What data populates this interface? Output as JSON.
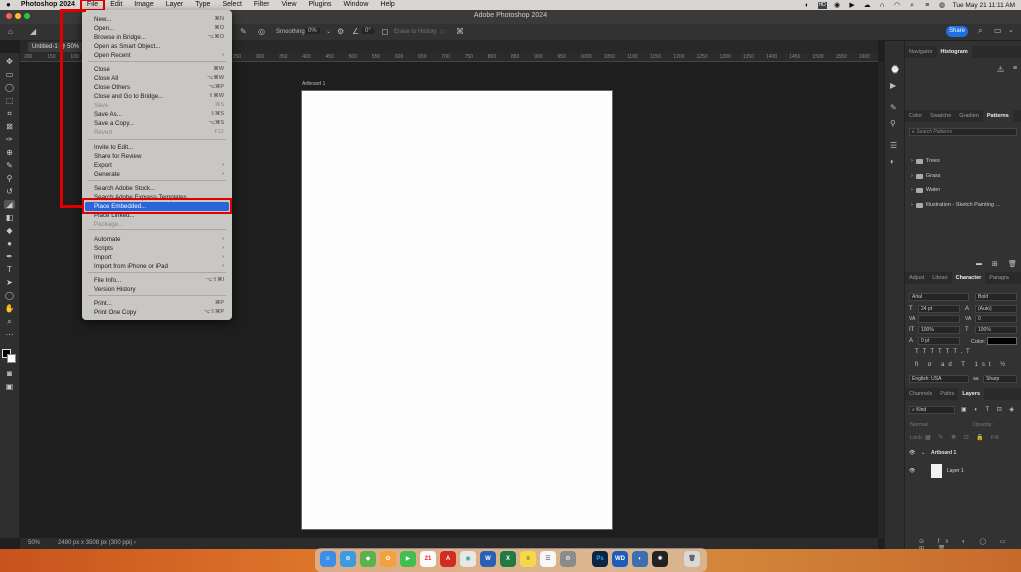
{
  "macos_menubar": {
    "app_name": "Photoshop 2024",
    "menus": [
      "File",
      "Edit",
      "Image",
      "Layer",
      "Type",
      "Select",
      "Filter",
      "View",
      "Plugins",
      "Window",
      "Help"
    ],
    "clock": "Tue May 21  11:11 AM"
  },
  "window": {
    "title": "Adobe Photoshop 2024"
  },
  "options_bar": {
    "smoothing_label": "Smoothing:",
    "smoothing_value": "0%",
    "angle_value": "0°",
    "erase_label": "Erase to History",
    "share_label": "Share"
  },
  "document": {
    "tab_title": "Untitled-1 @ 50%",
    "artboard_label": "Artboard 1",
    "zoom": "50%",
    "doc_info": "2480 px x 3508 px (300 ppi)",
    "ruler_ticks": [
      "200",
      "150",
      "100",
      "50",
      "0",
      "50",
      "100",
      "150",
      "200",
      "250",
      "300",
      "350",
      "400",
      "450",
      "500",
      "550",
      "600",
      "650",
      "700",
      "750",
      "800",
      "850",
      "900",
      "950",
      "1000",
      "1050",
      "1100",
      "1150",
      "1200",
      "1250",
      "1300",
      "1350",
      "1400",
      "1450",
      "1500",
      "1550",
      "1600"
    ]
  },
  "file_menu": {
    "items": [
      {
        "label": "New...",
        "shortcut": "⌘N",
        "disabled": false
      },
      {
        "label": "Open...",
        "shortcut": "⌘O",
        "disabled": false
      },
      {
        "label": "Browse in Bridge...",
        "shortcut": "⌥⌘O",
        "disabled": false
      },
      {
        "label": "Open as Smart Object...",
        "shortcut": "",
        "disabled": false
      },
      {
        "label": "Open Recent",
        "shortcut": "›",
        "disabled": false
      },
      {
        "label": "Close",
        "shortcut": "⌘W",
        "disabled": false
      },
      {
        "label": "Close All",
        "shortcut": "⌥⌘W",
        "disabled": false
      },
      {
        "label": "Close Others",
        "shortcut": "⌥⌘P",
        "disabled": false
      },
      {
        "label": "Close and Go to Bridge...",
        "shortcut": "⇧⌘W",
        "disabled": false
      },
      {
        "label": "Save",
        "shortcut": "⌘S",
        "disabled": true
      },
      {
        "label": "Save As...",
        "shortcut": "⇧⌘S",
        "disabled": false
      },
      {
        "label": "Save a Copy...",
        "shortcut": "⌥⌘S",
        "disabled": false
      },
      {
        "label": "Revert",
        "shortcut": "F12",
        "disabled": true
      },
      {
        "label": "Invite to Edit...",
        "shortcut": "",
        "disabled": false
      },
      {
        "label": "Share for Review",
        "shortcut": "",
        "disabled": false
      },
      {
        "label": "Export",
        "shortcut": "›",
        "disabled": false
      },
      {
        "label": "Generate",
        "shortcut": "›",
        "disabled": false
      },
      {
        "label": "Search Adobe Stock...",
        "shortcut": "",
        "disabled": false
      },
      {
        "label": "Search Adobe Express Templates...",
        "shortcut": "",
        "disabled": false
      },
      {
        "label": "Place Embedded...",
        "shortcut": "",
        "disabled": false,
        "selected": true
      },
      {
        "label": "Place Linked...",
        "shortcut": "",
        "disabled": false
      },
      {
        "label": "Package...",
        "shortcut": "",
        "disabled": true
      },
      {
        "label": "Automate",
        "shortcut": "›",
        "disabled": false
      },
      {
        "label": "Scripts",
        "shortcut": "›",
        "disabled": false
      },
      {
        "label": "Import",
        "shortcut": "›",
        "disabled": false
      },
      {
        "label": "Import from iPhone or iPad",
        "shortcut": "›",
        "disabled": false
      },
      {
        "label": "File Info...",
        "shortcut": "⌥⇧⌘I",
        "disabled": false
      },
      {
        "label": "Version History",
        "shortcut": "",
        "disabled": false
      },
      {
        "label": "Print...",
        "shortcut": "⌘P",
        "disabled": false
      },
      {
        "label": "Print One Copy",
        "shortcut": "⌥⇧⌘P",
        "disabled": false
      }
    ]
  },
  "right_panels": {
    "nav_tabs": [
      "Navigator",
      "Histogram"
    ],
    "swatch_tabs": [
      "Color",
      "Swatche",
      "Gradien",
      "Patterns"
    ],
    "pattern_search_placeholder": "Search Patterns",
    "pattern_groups": [
      "Trees",
      "Grass",
      "Water",
      "Illustration - Sketch Painting ..."
    ],
    "char_tabs": [
      "Adjust",
      "Librari",
      "Character",
      "Paragra"
    ],
    "character": {
      "font_family": "Arial",
      "font_style": "Bold",
      "size": "24 pt",
      "leading": "(Auto)",
      "kerning": "VA",
      "tracking": "0",
      "vscale": "100%",
      "hscale": "100%",
      "baseline": "0 pt",
      "color_label": "Color:",
      "language": "English: USA",
      "antialias": "Sharp"
    },
    "layer_tabs": [
      "Channels",
      "Paths",
      "Layers"
    ],
    "layers_filter": "Kind",
    "blend_mode": "Normal",
    "opacity_label": "Opacity:",
    "lock_label": "Lock:",
    "fill_label": "Fill:",
    "layers": [
      {
        "name": "Artboard 1",
        "type": "artboard"
      },
      {
        "name": "Layer 1",
        "type": "layer"
      }
    ]
  },
  "colors": {
    "accent_blue": "#2a64d8",
    "highlight_red": "#e00000",
    "share_blue": "#1f6fe5"
  }
}
